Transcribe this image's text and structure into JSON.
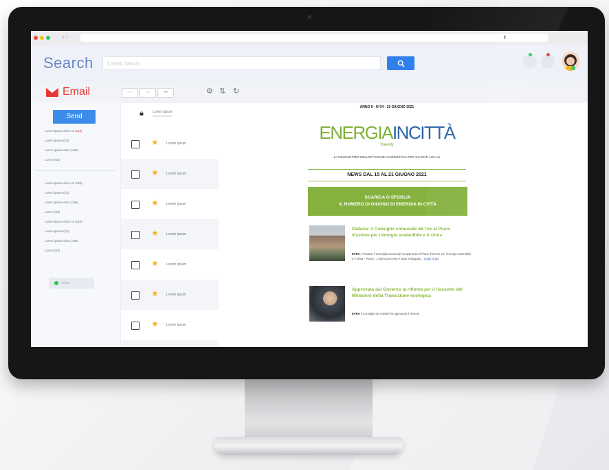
{
  "browser": {
    "nav_arrows": "‹ ›"
  },
  "header": {
    "logo": "Search",
    "search_placeholder": "Lorem ipsum...",
    "search_button_icon": "search-icon"
  },
  "toolbar": {
    "email_label": "Email",
    "btn_1": "‹ ›",
    "btn_2": "‹›",
    "btn_3": "•••",
    "icons": [
      "gear-icon",
      "sliders-icon",
      "refresh-icon"
    ]
  },
  "sidebar": {
    "send_label": "Send",
    "group1": [
      {
        "text": "Lorem ipsum dolor sit ",
        "highlight": "(118)"
      },
      {
        "text": "Lorem ipsum (23)",
        "highlight": ""
      },
      {
        "text": "Lorem ipsum dolor (194)",
        "highlight": ""
      },
      {
        "text": "Lorem (63)",
        "highlight": ""
      }
    ],
    "group2": [
      "Lorem ipsum dolor sit (118)",
      "Lorem ipsum (23)",
      "Lorem ipsum dolor (194)",
      "Lorem (63)",
      "Lorem ipsum dolor sit (118)",
      "Lorem ipsum (23)",
      "Lorem ipsum dolor (194)",
      "Lorem (63)"
    ],
    "status_label": "Online"
  },
  "messages": {
    "top_label": "Lorem ipsum",
    "rows": [
      "Lorem ipsum",
      "Lorem ipsum",
      "Lorem ipsum",
      "Lorem ipsum",
      "Lorem ipsum",
      "Lorem ipsum",
      "Lorem ipsum"
    ]
  },
  "newsletter": {
    "issue": "ANNO 6 - N°24 - 22 GIUGNO 2021",
    "brand_a": "ENERGIA",
    "brand_b": "INCITTÀ",
    "weekly": "Weekly",
    "tagline": "LA NEWSLETTER DELL'EFFICIENZA ENERGETICA PER GLI ENTI LOCALI",
    "news_range": "NEWS DAL 15 AL 21 GIUGNO 2021",
    "banner_line1": "SCARICA O SFOGLIA",
    "banner_line2": "IL NUMERO DI GIUGNO DI ENERGIA IN CITTÀ",
    "articles": [
      {
        "title": "Padova: il Consiglio comunale dà l'ok al Piano d'azione per l'energia sostenibile e il clima",
        "body_lead": "EVRA",
        "body": " A Padova il Consiglio comunale ha approvato il Piano d'azione per l'energia sostenibile e il clima - 'Paesc'. L'intero percorso è stato sviluppato...",
        "read_more": "Leggi di più"
      },
      {
        "title": "Approvata dal Governo la riforma per il riassetto del Ministero della Transizione ecologica",
        "body_lead": "EVRA",
        "body": " Il Consiglio dei ministri ha approvato il decreto",
        "read_more": ""
      }
    ]
  },
  "colors": {
    "accent_blue": "#2f80ed",
    "email_red": "#e53935",
    "newsletter_green": "#86b13f",
    "newsletter_blue": "#2b63a8",
    "star": "#f5b324"
  }
}
